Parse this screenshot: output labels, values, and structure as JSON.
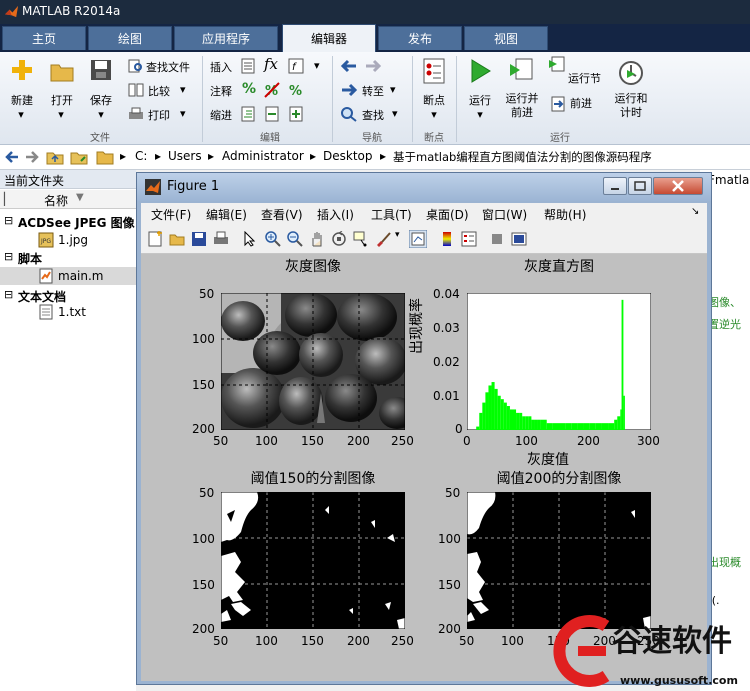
{
  "app": {
    "title": "MATLAB R2014a"
  },
  "tabs": [
    "主页",
    "绘图",
    "应用程序",
    "编辑器",
    "发布",
    "视图"
  ],
  "ribbon": {
    "file": {
      "new": "新建",
      "open": "打开",
      "save": "保存",
      "find_files": "查找文件",
      "compare": "比较",
      "print": "打印",
      "group": "文件"
    },
    "edit": {
      "insert": "插入",
      "comment": "注释",
      "indent": "缩进",
      "fx": "fx",
      "group": "编辑"
    },
    "nav": {
      "goto": "转至",
      "find": "查找",
      "group": "导航"
    },
    "breakpoints": {
      "label": "断点",
      "group": "断点"
    },
    "run": {
      "run": "运行",
      "run_advance": "运行并\n前进",
      "run_section": "运行节",
      "advance": "前进",
      "run_time": "运行和\n计时",
      "group": "运行"
    }
  },
  "address": {
    "parts": [
      "C:",
      "Users",
      "Administrator",
      "Desktop",
      "基于matlab编程直方图阈值法分割的图像源码程序"
    ]
  },
  "current_folder": {
    "title": "当前文件夹",
    "header": "名称",
    "groups": [
      {
        "name": "ACDSee JPEG 图像",
        "files": [
          "1.jpg"
        ]
      },
      {
        "name": "脚本",
        "files": [
          "main.m"
        ]
      },
      {
        "name": "文本文档",
        "files": [
          "1.txt"
        ]
      }
    ]
  },
  "right_text": [
    "Fmatla",
    "图像、",
    "置逆光",
    "出现概",
    "/(.",
    ")"
  ],
  "figure": {
    "title": "Figure 1",
    "menu": [
      "文件(F)",
      "编辑(E)",
      "查看(V)",
      "插入(I)",
      "工具(T)",
      "桌面(D)",
      "窗口(W)",
      "帮助(H)"
    ],
    "plots": {
      "gray": {
        "title": "灰度图像",
        "xticks": [
          "50",
          "100",
          "150",
          "200",
          "250"
        ],
        "yticks": [
          "50",
          "100",
          "150",
          "200"
        ]
      },
      "hist": {
        "title": "灰度直方图",
        "xlabel": "灰度值",
        "ylabel": "出现概率",
        "xticks": [
          "0",
          "100",
          "200",
          "300"
        ],
        "yticks": [
          "0",
          "0.01",
          "0.02",
          "0.03",
          "0.04"
        ]
      },
      "seg150": {
        "title": "阈值150的分割图像",
        "xticks": [
          "50",
          "100",
          "150",
          "200",
          "250"
        ],
        "yticks": [
          "50",
          "100",
          "150",
          "200"
        ]
      },
      "seg200": {
        "title": "阈值200的分割图像",
        "xticks": [
          "50",
          "100",
          "150",
          "200",
          "250"
        ],
        "yticks": [
          "50",
          "100",
          "150",
          "200"
        ]
      }
    }
  },
  "chart_data": {
    "type": "bar",
    "title": "灰度直方图",
    "xlabel": "灰度值",
    "ylabel": "出现概率",
    "xlim": [
      0,
      300
    ],
    "ylim": [
      0,
      0.04
    ],
    "x": [
      0,
      5,
      10,
      15,
      20,
      25,
      30,
      35,
      40,
      45,
      50,
      55,
      60,
      65,
      70,
      75,
      80,
      85,
      90,
      95,
      100,
      105,
      110,
      115,
      120,
      130,
      140,
      150,
      160,
      170,
      180,
      190,
      200,
      210,
      220,
      230,
      240,
      245,
      250,
      252,
      255
    ],
    "values": [
      0,
      0,
      0,
      0.001,
      0.005,
      0.008,
      0.011,
      0.013,
      0.014,
      0.012,
      0.01,
      0.009,
      0.008,
      0.007,
      0.006,
      0.006,
      0.005,
      0.005,
      0.004,
      0.004,
      0.004,
      0.003,
      0.003,
      0.003,
      0.003,
      0.002,
      0.002,
      0.002,
      0.002,
      0.002,
      0.002,
      0.002,
      0.002,
      0.002,
      0.002,
      0.002,
      0.003,
      0.004,
      0.006,
      0.038,
      0.01
    ],
    "color": "#00ff00"
  },
  "watermark": {
    "brand": "谷速软件",
    "url": "www.gususoft.com"
  }
}
